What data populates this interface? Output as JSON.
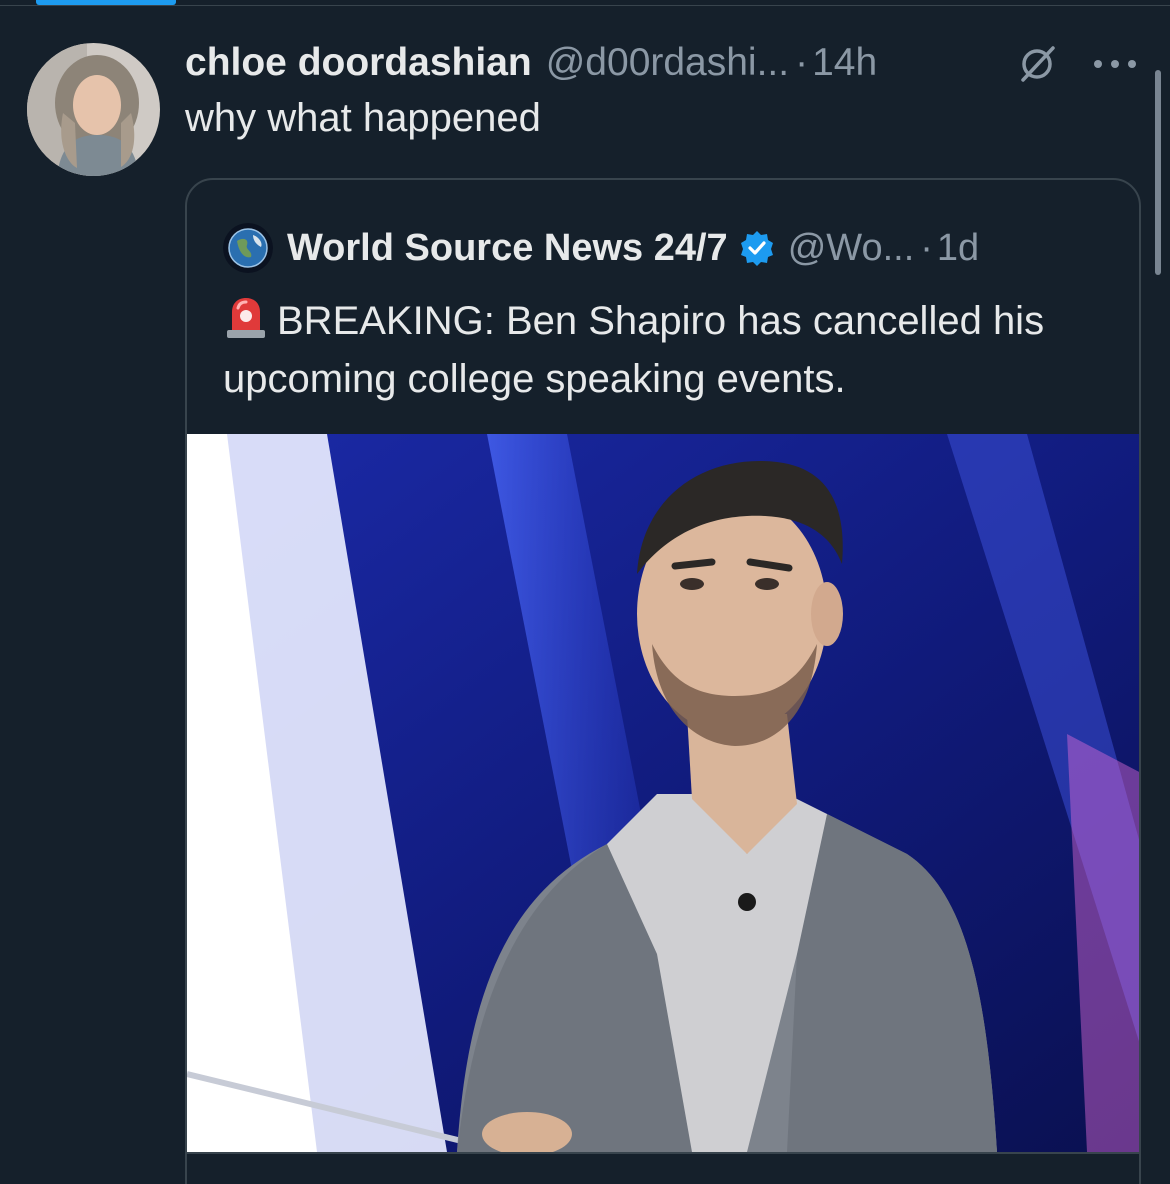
{
  "colors": {
    "background": "#15202b",
    "text_primary": "#e7e9ea",
    "text_secondary": "#8b98a5",
    "border": "#38444d",
    "accent": "#1d9bf0"
  },
  "tweet": {
    "author_name": "chloe doordashian",
    "author_handle": "@d00rdashi...",
    "separator": "·",
    "time": "14h",
    "text": "why what happened",
    "icons": [
      "grok-icon",
      "more-icon"
    ]
  },
  "quoted_tweet": {
    "author_name": "World Source News 24/7",
    "verified": true,
    "author_handle": "@Wo...",
    "separator": "·",
    "time": "1d",
    "siren": "🚨",
    "text": "BREAKING: Ben Shapiro has cancelled his upcoming college speaking events.",
    "icons": [
      "globe-avatar-icon",
      "verified-badge-icon",
      "siren-icon"
    ]
  }
}
